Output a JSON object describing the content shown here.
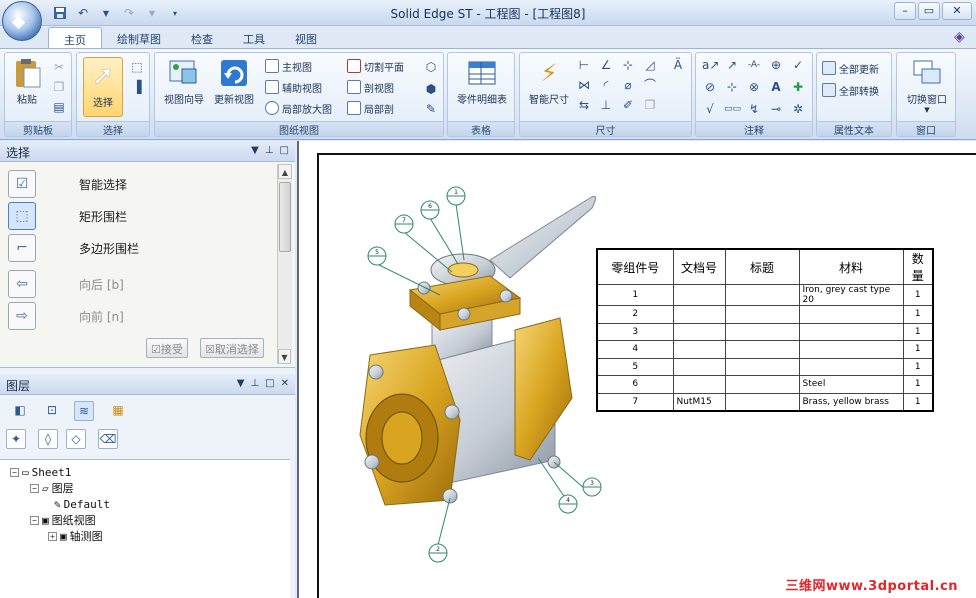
{
  "app": {
    "title": "Solid Edge ST - 工程图 - [工程图8]"
  },
  "quick_access": {
    "save": "save-icon",
    "undo": "undo-icon",
    "redo": "redo-icon",
    "customize": "dropdown-icon"
  },
  "ribbon_tabs": [
    "主页",
    "绘制草图",
    "检查",
    "工具",
    "视图"
  ],
  "ribbon": {
    "groups": {
      "clipboard": "剪贴板",
      "select": "选择",
      "drawing_views": "图纸视图",
      "tables": "表格",
      "dimensions": "尺寸",
      "annotations": "注释",
      "property_text": "属性文本",
      "window": "窗口"
    },
    "paste": "粘贴",
    "select": "选择",
    "view_wizard": "视图向导",
    "update_views": "更新视图",
    "principal_view": "主视图",
    "auxiliary_view": "辅助视图",
    "detail_view": "局部放大图",
    "cutting_plane": "切割平面",
    "section_view": "剖视图",
    "broken_out": "局部剖",
    "parts_list": "零件明细表",
    "smart_dimension": "智能尺寸",
    "update_all": "全部更新",
    "convert_all": "全部转换",
    "switch_window": "切换窗口"
  },
  "select_panel": {
    "title": "选择",
    "items": [
      {
        "label": "智能选择",
        "icon": "smart-select-icon",
        "enabled": true
      },
      {
        "label": "矩形围栏",
        "icon": "rectangle-fence-icon",
        "enabled": true
      },
      {
        "label": "多边形围栏",
        "icon": "polygon-fence-icon",
        "enabled": true
      },
      {
        "label": "向后 [b]",
        "icon": "arrow-left-icon",
        "enabled": false
      },
      {
        "label": "向前 [n]",
        "icon": "arrow-right-icon",
        "enabled": false
      }
    ],
    "accept": "接受",
    "cancel": "取消选择"
  },
  "layers_panel": {
    "title": "图层",
    "tree": {
      "sheet": "Sheet1",
      "layers": "图层",
      "default": "Default",
      "drawing_views": "图纸视图",
      "isometric": "轴测图"
    }
  },
  "parts_list": {
    "headers": [
      "零组件号",
      "文档号",
      "标题",
      "材料",
      "数量"
    ],
    "rows": [
      [
        "1",
        "",
        "",
        "Iron, grey cast type 20",
        "1"
      ],
      [
        "2",
        "",
        "",
        "",
        "1"
      ],
      [
        "3",
        "",
        "",
        "",
        "1"
      ],
      [
        "4",
        "",
        "",
        "",
        "1"
      ],
      [
        "5",
        "",
        "",
        "",
        "1"
      ],
      [
        "6",
        "",
        "",
        "Steel",
        "1"
      ],
      [
        "7",
        "NutM15",
        "",
        "Brass, yellow brass",
        "1"
      ]
    ]
  },
  "balloons": [
    "5",
    "7",
    "6",
    "1",
    "3",
    "4",
    "2"
  ],
  "watermark": "三维网www.3dportal.cn",
  "colors": {
    "brass": "#d9a520",
    "steel": "#c9cfd6",
    "accent": "#ffd56e",
    "balloon": "#2b8a6e"
  }
}
